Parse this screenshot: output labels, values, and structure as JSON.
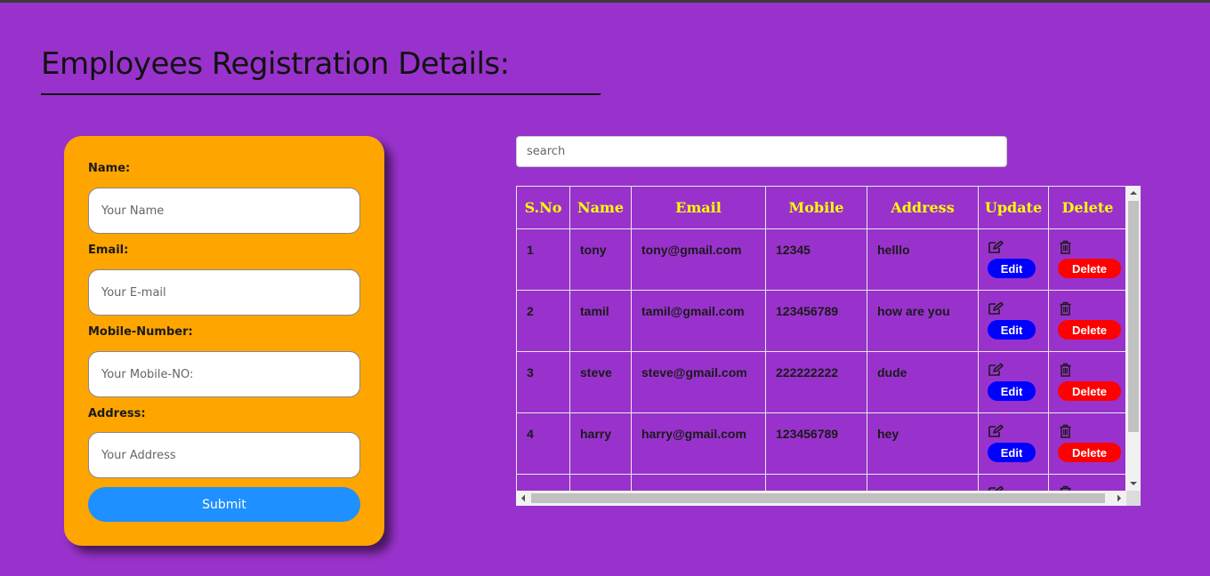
{
  "page": {
    "title": "Employees Registration Details:"
  },
  "form": {
    "name_label": "Name:",
    "name_placeholder": "Your Name",
    "email_label": "Email:",
    "email_placeholder": "Your E-mail",
    "mobile_label": "Mobile-Number:",
    "mobile_placeholder": "Your Mobile-NO:",
    "address_label": "Address:",
    "address_placeholder": "Your Address",
    "submit_label": "Submit"
  },
  "search": {
    "placeholder": "search"
  },
  "table": {
    "headers": [
      "S.No",
      "Name",
      "Email",
      "Mobile",
      "Address",
      "Update",
      "Delete"
    ],
    "edit_label": "Edit",
    "delete_label": "Delete",
    "edit_icon": "edit-icon",
    "delete_icon": "trash-icon",
    "rows": [
      {
        "sno": "1",
        "name": "tony",
        "email": "tony@gmail.com",
        "mobile": "12345",
        "address": "helllo"
      },
      {
        "sno": "2",
        "name": "tamil",
        "email": "tamil@gmail.com",
        "mobile": "123456789",
        "address": "how are you"
      },
      {
        "sno": "3",
        "name": "steve",
        "email": "steve@gmail.com",
        "mobile": "222222222",
        "address": "dude"
      },
      {
        "sno": "4",
        "name": "harry",
        "email": "harry@gmail.com",
        "mobile": "123456789",
        "address": "hey"
      },
      {
        "sno": "",
        "name": "",
        "email": "",
        "mobile": "",
        "address": ""
      }
    ]
  },
  "colors": {
    "background": "#9932cc",
    "card": "#ffa500",
    "submit": "#1e90ff",
    "header_text": "#ffff00",
    "edit_button": "#0000ff",
    "delete_button": "#ff0000"
  }
}
